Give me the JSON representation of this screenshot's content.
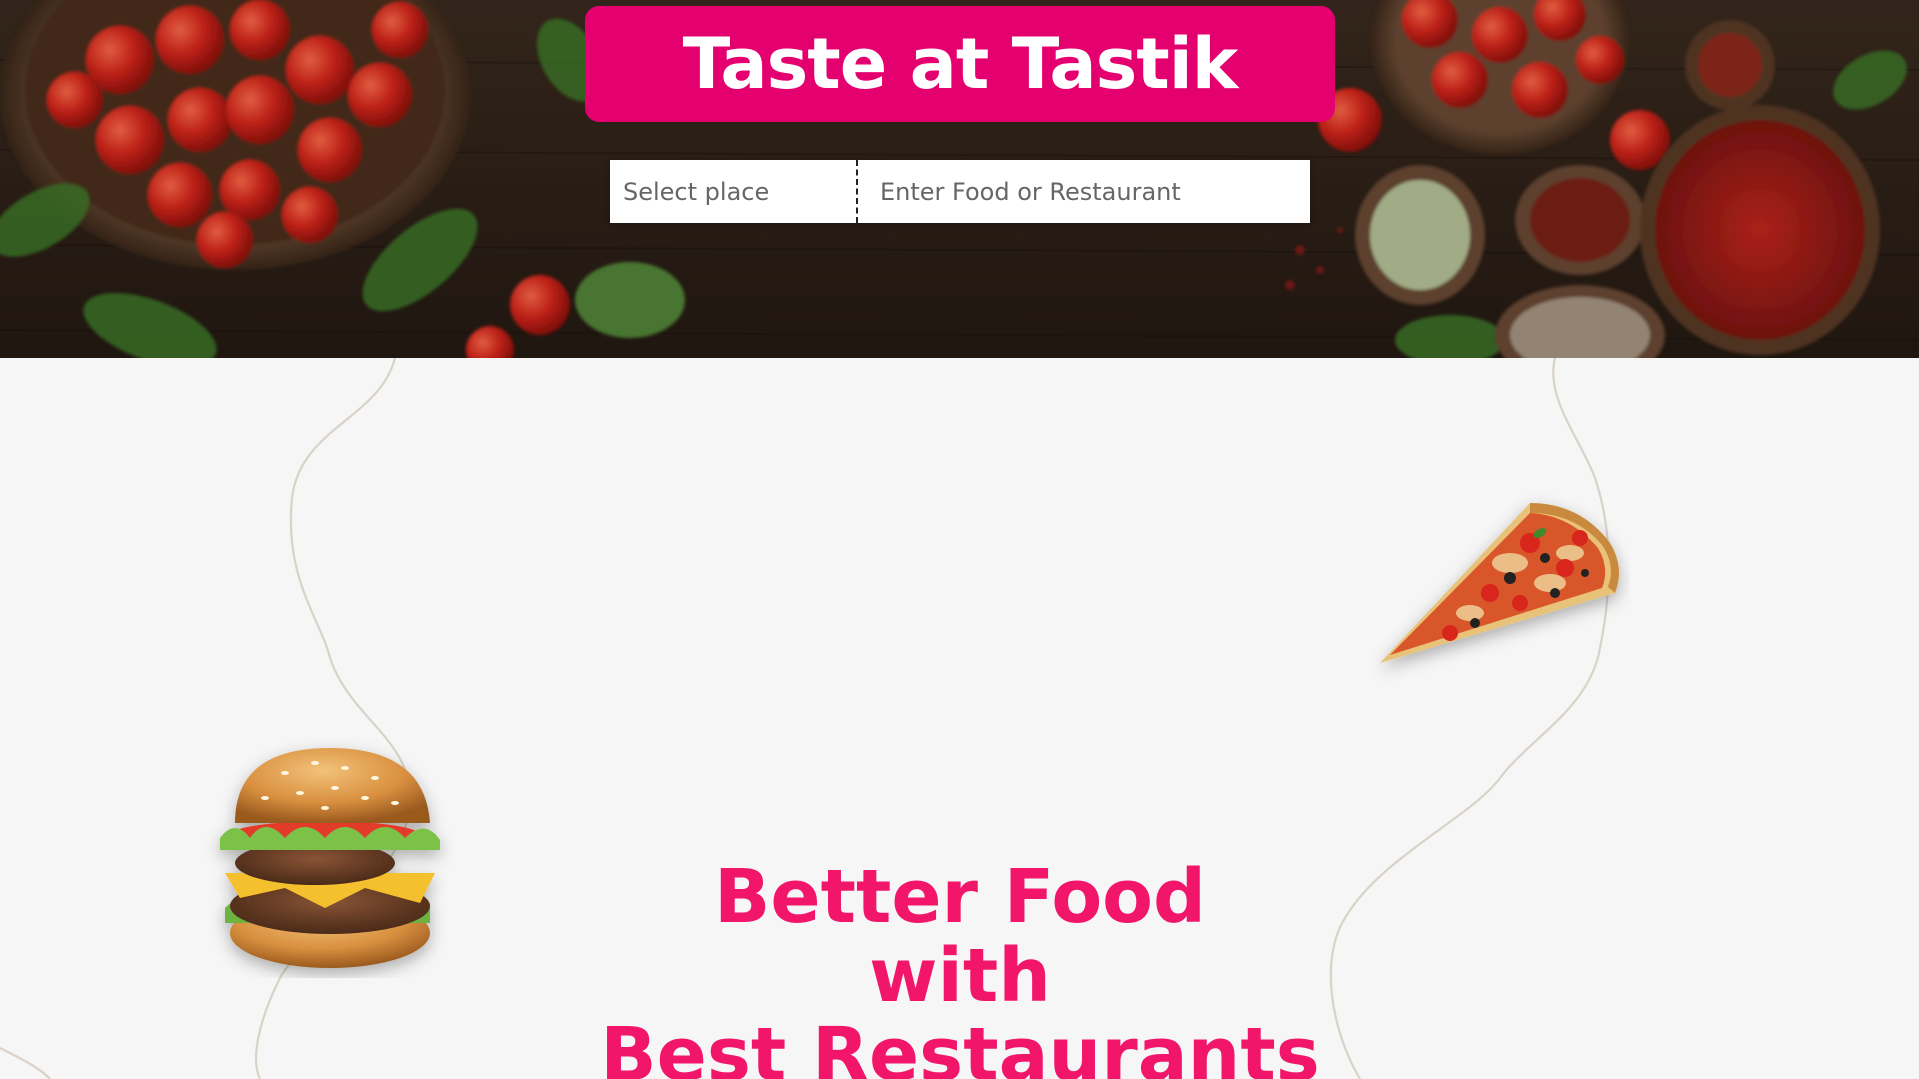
{
  "brand": {
    "title": "Taste at Tastik",
    "banner_color": "#e5006f"
  },
  "search": {
    "place_placeholder": "Select place",
    "food_placeholder": "Enter Food or Restaurant"
  },
  "tagline": {
    "line1": "Better Food",
    "line2": "with",
    "line3": "Best Restaurants",
    "color": "#f2166b"
  },
  "decorations": {
    "hero_background": "tomatoes-and-spices-photo",
    "burger": "burger-image",
    "pizza": "pizza-slice-image"
  }
}
